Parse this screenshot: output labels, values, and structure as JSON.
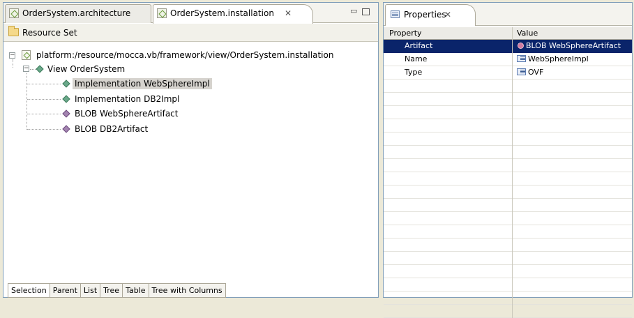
{
  "editor": {
    "tabs": [
      {
        "label": "OrderSystem.architecture"
      },
      {
        "label": "OrderSystem.installation"
      }
    ],
    "tab_close_glyph": "✕",
    "minimize_glyph": "▭",
    "resource_set_label": "Resource Set",
    "tree": {
      "root": "platform:/resource/mocca.vb/framework/view/OrderSystem.installation",
      "view": "View OrderSystem",
      "children": [
        {
          "label": "Implementation WebSphereImpl",
          "selected": true
        },
        {
          "label": "Implementation DB2Impl"
        },
        {
          "label": "BLOB WebSphereArtifact"
        },
        {
          "label": "BLOB DB2Artifact"
        }
      ]
    },
    "bottom_tabs": [
      "Selection",
      "Parent",
      "List",
      "Tree",
      "Table",
      "Tree with Columns"
    ]
  },
  "properties": {
    "tab_label": "Properties",
    "columns": [
      "Property",
      "Value"
    ],
    "rows": [
      {
        "property": "Artifact",
        "value": "BLOB WebSphereArtifact",
        "selected": true,
        "icon": "blob-gear-icon"
      },
      {
        "property": "Name",
        "value": "WebSphereImpl",
        "icon": "text-field-icon"
      },
      {
        "property": "Type",
        "value": "OVF",
        "icon": "text-field-icon"
      }
    ]
  },
  "colors": {
    "selection": "#0a246a",
    "tree_selection": "#d6d3ce",
    "diamond_green": "#6aa88a",
    "diamond_purple": "#a384b0"
  }
}
